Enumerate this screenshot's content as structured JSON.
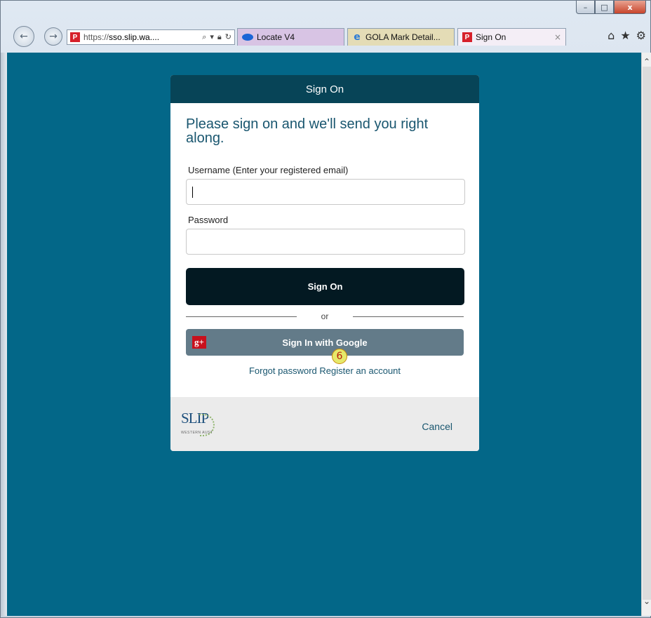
{
  "browser": {
    "url_scheme": "https://",
    "url_host": "sso.slip.wa....",
    "tabs": [
      {
        "label": "Locate V4"
      },
      {
        "label": "GOLA Mark Detail..."
      },
      {
        "label": "Sign On"
      }
    ],
    "tab_close": "×",
    "window_buttons": {
      "minimize": "–",
      "maximize": "□",
      "close": "x"
    }
  },
  "dialog": {
    "title": "Sign On",
    "heading": "Please sign on and we'll send you right along.",
    "username_label": "Username (Enter your registered email)",
    "username_value": "",
    "password_label": "Password",
    "password_value": "",
    "signon_button": "Sign On",
    "divider_text": "or",
    "google_button": "Sign In with Google",
    "google_icon_text": "g+",
    "links": {
      "forgot": "Forgot password",
      "register": "Register an account"
    },
    "cancel": "Cancel",
    "logo_text": "SLIP",
    "logo_subtext": "WESTERN AUST"
  },
  "annotation": {
    "marker": "6"
  },
  "colors": {
    "page_bg": "#036788",
    "dialog_header": "#074457",
    "signon_button": "#031922",
    "google_button": "#637b89",
    "heading": "#19566f"
  }
}
